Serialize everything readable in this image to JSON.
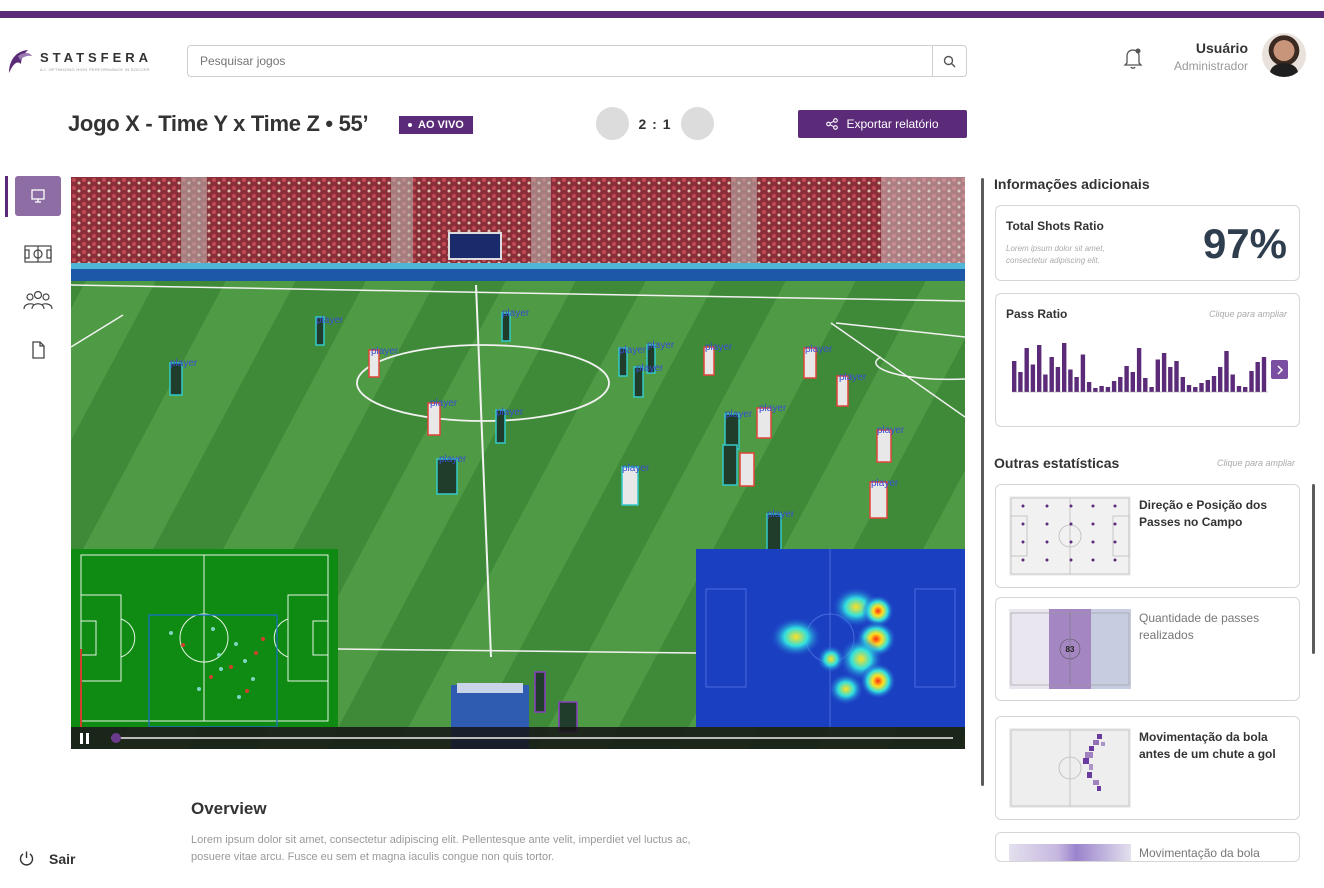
{
  "header": {
    "logo_name": "STATSFERA",
    "logo_tagline": "A.I. OPTIMIZING HIGH PERFORMANCE IN SOCCER",
    "search_placeholder": "Pesquisar jogos",
    "user_name": "Usuário",
    "user_role": "Administrador"
  },
  "match": {
    "title": "Jogo X - Time Y x Time Z  •  55’",
    "status": "AO VIVO",
    "score": "2 : 1",
    "export_label": "Exportar relatório"
  },
  "nav": {
    "items": [
      "monitor-icon",
      "field-icon",
      "team-icon",
      "document-icon"
    ],
    "logout_label": "Sair"
  },
  "video": {
    "detection_label": "player",
    "progress": 0.05
  },
  "overview": {
    "title": "Overview",
    "text": "Lorem ipsum dolor sit amet, consectetur adipiscing elit. Pellentesque ante velit, imperdiet vel luctus ac, posuere vitae arcu. Fusce eu sem et magna iaculis congue non quis tortor."
  },
  "sidebar": {
    "additional_title": "Informações adicionais",
    "shots": {
      "title": "Total Shots Ratio",
      "desc": "Lorem ipsum dolor sit amet, consectetur adipiscing elit.",
      "value": "97%"
    },
    "pass": {
      "title": "Pass Ratio",
      "hint": "Clique para ampliar",
      "bars": [
        0.62,
        0.4,
        0.88,
        0.55,
        0.94,
        0.35,
        0.7,
        0.5,
        0.98,
        0.45,
        0.3,
        0.75,
        0.2,
        0.08,
        0.12,
        0.1,
        0.22,
        0.3,
        0.52,
        0.4,
        0.88,
        0.28,
        0.1,
        0.65,
        0.78,
        0.5,
        0.62,
        0.3,
        0.14,
        0.1,
        0.18,
        0.24,
        0.32,
        0.5,
        0.82,
        0.35,
        0.12,
        0.1,
        0.42,
        0.6,
        0.7
      ]
    },
    "other_title": "Outras estatísticas",
    "other_hint": "Clique para ampliar",
    "stats": [
      {
        "label": "Direção e Posição dos Passes no Campo"
      },
      {
        "label": "Quantidade de passes realizados",
        "center_value": "83"
      },
      {
        "label": "Movimentação da bola antes de um chute a gol"
      },
      {
        "label": "Movimentação da bola"
      }
    ]
  },
  "colors": {
    "brand": "#5b2a78",
    "nav_active": "#8d6da3",
    "pitch": "#2f7a2c",
    "box_team_a": "#e0443a",
    "box_team_b": "#35c9c9"
  }
}
